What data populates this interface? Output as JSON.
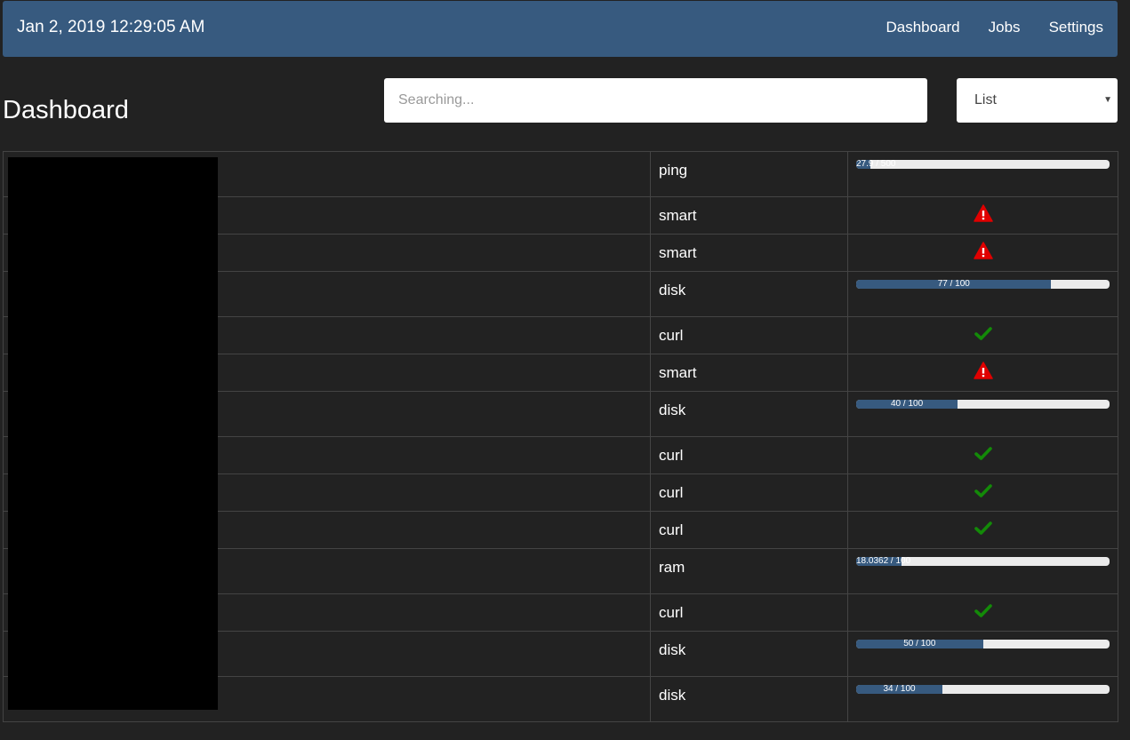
{
  "navbar": {
    "datetime": "Jan 2, 2019 12:29:05 AM",
    "links": [
      "Dashboard",
      "Jobs",
      "Settings"
    ]
  },
  "page": {
    "title": "Dashboard"
  },
  "search": {
    "placeholder": "Searching...",
    "value": ""
  },
  "view_select": {
    "selected": "List"
  },
  "colors": {
    "navbar": "#375a7f",
    "background": "#222222",
    "ok": "#138a08",
    "error": "#e00000",
    "progress_fill": "#375a7f",
    "progress_track": "#ebebeb"
  },
  "jobs": [
    {
      "type": "ping",
      "status": "bar",
      "label": "27.9 / 500",
      "fraction": 0.0558
    },
    {
      "type": "smart",
      "status": "warning-icon"
    },
    {
      "type": "smart",
      "status": "warning-icon"
    },
    {
      "type": "disk",
      "status": "bar",
      "label": "77 / 100",
      "fraction": 0.77
    },
    {
      "type": "curl",
      "status": "check-icon"
    },
    {
      "type": "smart",
      "status": "warning-icon"
    },
    {
      "type": "disk",
      "status": "bar",
      "label": "40 / 100",
      "fraction": 0.4
    },
    {
      "type": "curl",
      "status": "check-icon"
    },
    {
      "type": "curl",
      "status": "check-icon"
    },
    {
      "type": "curl",
      "status": "check-icon"
    },
    {
      "type": "ram",
      "status": "bar",
      "label": "18.0362 / 100",
      "fraction": 0.180362
    },
    {
      "type": "curl",
      "status": "check-icon"
    },
    {
      "type": "disk",
      "status": "bar",
      "label": "50 / 100",
      "fraction": 0.5
    },
    {
      "type": "disk",
      "status": "bar",
      "label": "34 / 100",
      "fraction": 0.34
    }
  ]
}
